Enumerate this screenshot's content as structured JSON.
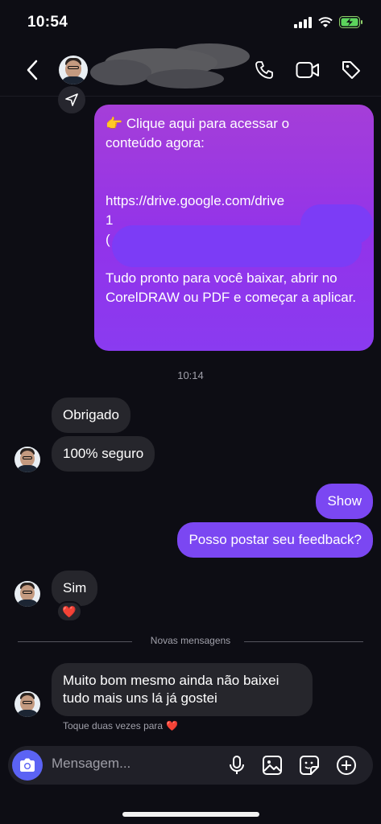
{
  "status_bar": {
    "time": "10:54"
  },
  "header": {
    "back_icon": "chevron-left-icon",
    "actions": [
      "phone-icon",
      "video-icon",
      "tag-icon"
    ]
  },
  "messages": {
    "big_bubble": {
      "line1": "👉 Clique aqui para acessar o conteúdo agora:",
      "link_partial": "https://drive.google.com/drive",
      "link_fragment_2": "1",
      "link_fragment_3": "(",
      "body": "Tudo pronto para você baixar, abrir no CorelDRAW ou PDF e começar a aplicar."
    },
    "timestamp": "10:14",
    "in_1": "Obrigado",
    "in_2": "100% seguro",
    "out_1": "Show",
    "out_2": "Posso postar seu feedback?",
    "in_3": "Sim",
    "reaction": "❤️",
    "divider_label": "Novas mensagens",
    "in_4": "Muito bom mesmo ainda não baixei tudo mais uns lá já gostei",
    "hint": "Toque duas vezes para",
    "hint_emoji": "❤️"
  },
  "composer": {
    "placeholder": "Mensagem..."
  },
  "colors": {
    "background": "#0d0d14",
    "incoming_bubble": "#26262c",
    "outgoing_bubble": "#7b47f2",
    "camera_button": "#5b63f4"
  }
}
